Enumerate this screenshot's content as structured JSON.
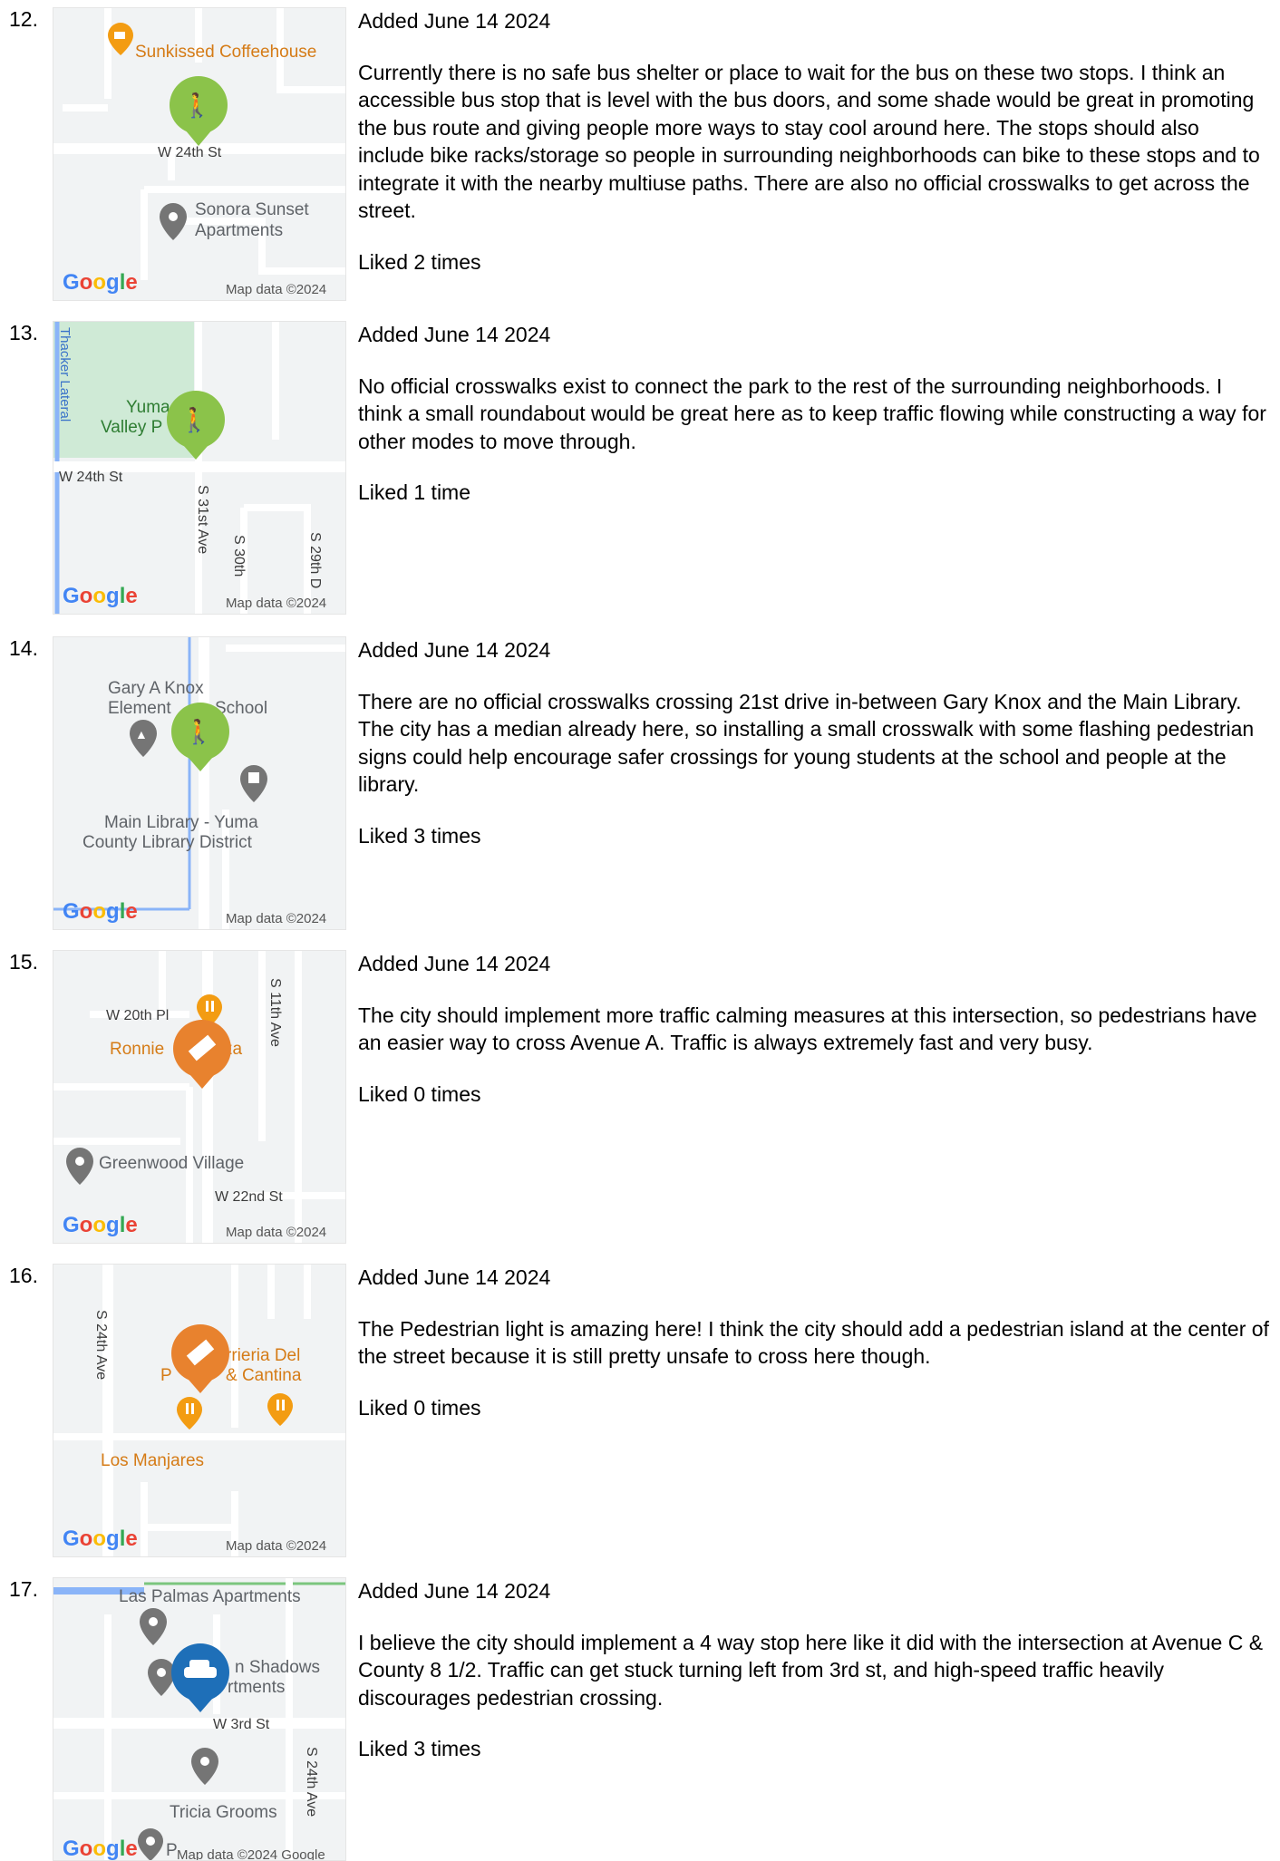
{
  "entries": [
    {
      "number": "12.",
      "added": "Added June 14 2024",
      "comment": "Currently there is no safe bus shelter or place to wait for the bus on these two stops. I think an accessible bus stop that is level with the bus doors, and some shade would be great in promoting the bus route and giving people more ways to stay cool around here. The stops should also include bike racks/storage so people in surrounding neighborhoods can bike to these stops and to integrate it with the nearby multiuse paths. There are also no official crosswalks to get across the street.",
      "likes": "Liked 2 times",
      "map": {
        "labels": [
          "Sunkissed Coffeehouse",
          "W 24th St",
          "Sonora Sunset",
          "Apartments"
        ],
        "attribution": "Map data ©2024",
        "logo": "Google",
        "marker_icon": "pedestrian-bicycle-icon",
        "marker_color": "#8bc34a"
      }
    },
    {
      "number": "13.",
      "added": "Added June 14 2024",
      "comment": "No official crosswalks exist to connect the park to the rest of the surrounding neighborhoods. I think a small roundabout would be great here as to keep traffic flowing while constructing a way for other modes to move through.",
      "likes": "Liked 1 time",
      "map": {
        "labels": [
          "Thacker Lateral",
          "Yuma",
          "Valley P",
          "W 24th St",
          "S 31st Ave",
          "S 30th",
          "S 29th D"
        ],
        "attribution": "Map data ©2024",
        "logo": "Google",
        "marker_icon": "pedestrian-bicycle-icon",
        "marker_color": "#8bc34a"
      }
    },
    {
      "number": "14.",
      "added": "Added June 14 2024",
      "comment": "There are no official crosswalks crossing 21st drive in-between Gary Knox and the Main Library. The city has a median already here, so installing a small crosswalk with some flashing pedestrian signs could help encourage safer crossings for young students at the school and people at the library.",
      "likes": "Liked 3 times",
      "map": {
        "labels": [
          "Gary A Knox",
          "Element",
          "School",
          "Main Library - Yuma",
          "County Library District"
        ],
        "attribution": "Map data ©2024",
        "logo": "Google",
        "marker_icon": "pedestrian-bicycle-icon",
        "marker_color": "#8bc34a"
      }
    },
    {
      "number": "15.",
      "added": "Added June 14 2024",
      "comment": "The city should implement more traffic calming measures at this intersection, so pedestrians have an easier way to cross Avenue A. Traffic is always extremely fast and very busy.",
      "likes": "Liked 0 times",
      "map": {
        "labels": [
          "W 20th Pl",
          "Ronnie",
          "za",
          "S 11th Ave",
          "Greenwood Village",
          "W 22nd St"
        ],
        "attribution": "Map data ©2024",
        "logo": "Google",
        "marker_icon": "crosswalk-icon",
        "marker_color": "#e8822e"
      }
    },
    {
      "number": "16.",
      "added": "Added June 14 2024",
      "comment": "The Pedestrian light is amazing here! I think the city should add a pedestrian island at the center of the street because it is still pretty unsafe to cross here though.",
      "likes": "Liked 0 times",
      "map": {
        "labels": [
          "S 24th Ave",
          "rrieria Del",
          "P",
          "& Cantina",
          "Los Manjares"
        ],
        "attribution": "Map data ©2024",
        "logo": "Google",
        "marker_icon": "crosswalk-icon",
        "marker_color": "#e8822e"
      }
    },
    {
      "number": "17.",
      "added": "Added June 14 2024",
      "comment": "I believe the city should implement a 4 way stop here like it did with the intersection at Avenue C & County 8 1/2. Traffic can get stuck turning left from 3rd st, and high-speed traffic heavily discourages pedestrian crossing.",
      "likes": "Liked 3 times",
      "map": {
        "labels": [
          "Las Palmas Apartments",
          "n Shadows",
          "rtments",
          "W 3rd St",
          "S 24th Ave",
          "Tricia Grooms",
          "P"
        ],
        "attribution": "Map data ©2024 Google",
        "logo": "Google",
        "marker_icon": "car-icon",
        "marker_color": "#1e6fb8"
      }
    }
  ]
}
